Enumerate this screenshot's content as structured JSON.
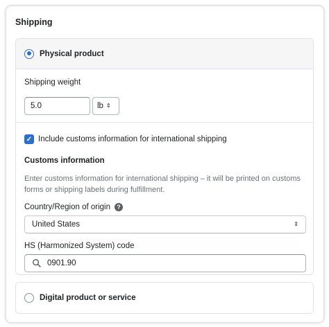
{
  "card": {
    "title": "Shipping"
  },
  "physical": {
    "label": "Physical product",
    "selected": true,
    "weight_label": "Shipping weight",
    "weight_value": "5.0",
    "unit": "lb",
    "customs_checkbox_label": "Include customs information for international shipping",
    "customs_checked": true,
    "customs_heading": "Customs information",
    "customs_help": "Enter customs information for international shipping – it will be printed on customs forms or shipping labels during fulfillment.",
    "country_label": "Country/Region of origin",
    "country_value": "United States",
    "hs_label": "HS (Harmonized System) code",
    "hs_value": "0901.90"
  },
  "digital": {
    "label": "Digital product or service",
    "selected": false
  },
  "icons": {
    "radio": "radio-icon",
    "help": "question-circle-icon",
    "select": "select-updown-icon",
    "search": "search-icon"
  },
  "colors": {
    "accent": "#2c6ecb",
    "border": "#dfe3e8",
    "subdued_text": "#6d7175"
  }
}
